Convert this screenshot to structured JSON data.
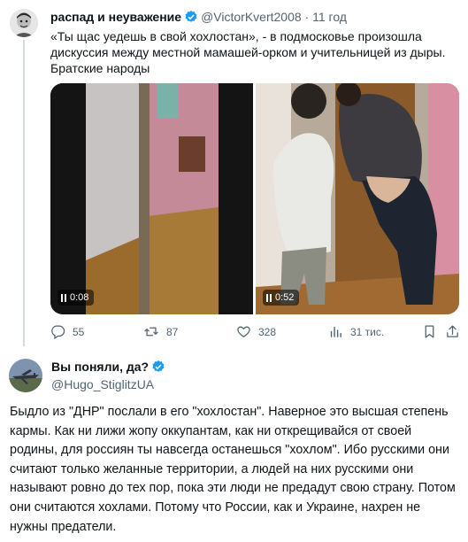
{
  "tweet1": {
    "author_name": "распад и неуважение",
    "handle": "@VictorKvert2008",
    "time": "11 год",
    "text": "«Ты щас уедешь в свой хохлостан», - в подмосковье произошла дискуссия между местной мамашей-орком и учительницей из дыры. Братские народы",
    "videos": [
      {
        "duration": "0:08"
      },
      {
        "duration": "0:52"
      }
    ],
    "stats": {
      "replies": "55",
      "retweets": "87",
      "likes": "328",
      "views": "31 тис."
    }
  },
  "tweet2": {
    "author_name": "Вы поняли, да?",
    "handle": "@Hugo_StiglitzUA",
    "text": "Быдло из \"ДНР\" послали в его \"хохлостан\". Наверное это высшая степень кармы. Как ни лижи жопу оккупантам, как ни открещивайся от своей родины, для россиян ты навсегда останешься \"хохлом\". Ибо русскими они считают только желанные территории, а людей на них русскими они называют ровно до тех пор, пока эти люди не предадут свою страну. Потом они считаются хохлами. Потому что России, как и Украине, нахрен не нужны предатели."
  },
  "colors": {
    "verified": "#1d9bf0",
    "muted": "#536471",
    "thread_line": "#cfd9de"
  }
}
